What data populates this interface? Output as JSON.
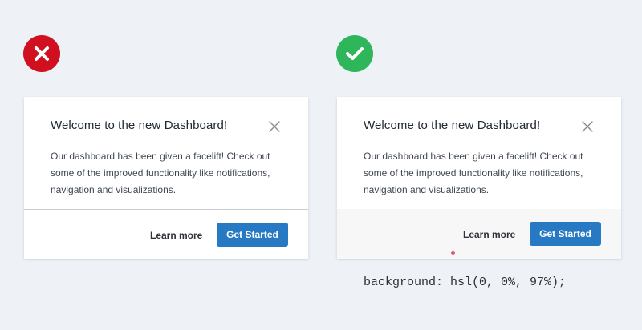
{
  "comparison": {
    "bad_example": {
      "status_icon": "x-icon",
      "status_color": "#d0101e",
      "card": {
        "title": "Welcome to the new Dashboard!",
        "body": "Our dashboard has been given a facelift! Check out some of the improved functionality like notifications, navigation and visualizations.",
        "close_icon": "close-icon",
        "footer_background": "#ffffff",
        "footer_divider_color": "#c8ccd2",
        "secondary_action_label": "Learn more",
        "primary_action_label": "Get Started"
      }
    },
    "good_example": {
      "status_icon": "check-icon",
      "status_color": "#2fb55a",
      "card": {
        "title": "Welcome to the new Dashboard!",
        "body": "Our dashboard has been given a facelift! Check out some of the improved functionality like notifications, navigation and visualizations.",
        "close_icon": "close-icon",
        "footer_background": "#f7f7f7",
        "secondary_action_label": "Learn more",
        "primary_action_label": "Get Started"
      },
      "annotation": {
        "code": "background: hsl(0, 0%, 97%);",
        "pointer_color": "#e2566d"
      }
    },
    "primary_button_color": "#2679c2",
    "page_background": "#eef2f7"
  }
}
